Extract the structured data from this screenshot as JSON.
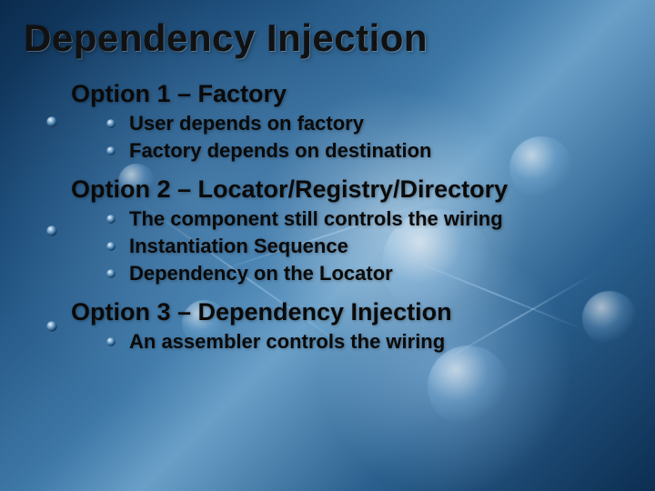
{
  "title": "Dependency  Injection",
  "items": [
    {
      "label": "Option 1 – Factory",
      "sub": [
        "User depends on factory",
        "Factory depends on destination"
      ]
    },
    {
      "label": "Option 2 – Locator/Registry/Directory",
      "sub": [
        "The component still controls the wiring",
        "Instantiation Sequence",
        "Dependency on the Locator"
      ]
    },
    {
      "label": "Option 3 – Dependency Injection",
      "sub": [
        "An assembler controls the wiring"
      ]
    }
  ]
}
